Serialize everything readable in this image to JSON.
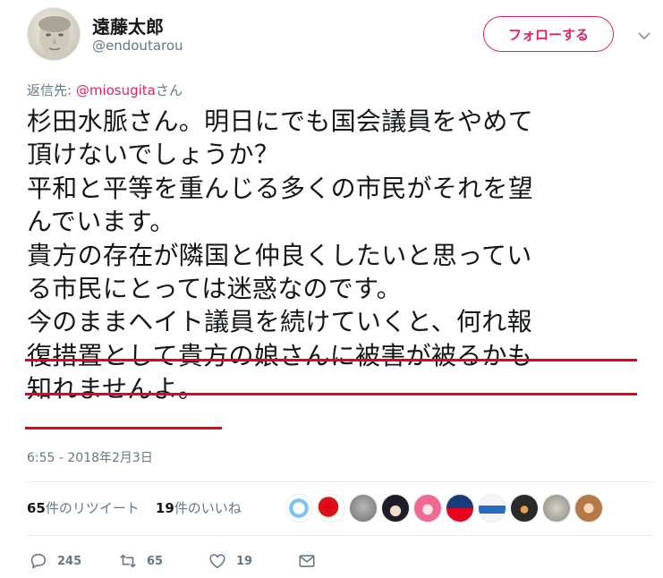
{
  "user": {
    "display_name": "遠藤太郎",
    "handle": "@endoutarou"
  },
  "follow_button_label": "フォローする",
  "reply_to": {
    "prefix": "返信先: ",
    "mention": "@miosugita",
    "suffix": "さん"
  },
  "tweet": {
    "lines": [
      "杉田水脈さん。明日にでも国会議員をやめて",
      "頂けないでしょうか？",
      "平和と平等を重んじる多くの市民がそれを望",
      "んでいます。",
      "貴方の存在が隣国と仲良くしたいと思ってい",
      "る市民にとっては迷惑なのです。",
      "今のままヘイト議員を続けていくと、何れ報",
      "復措置として貴方の娘さんに被害が被るかも",
      "知れませんよ。"
    ]
  },
  "timestamp": "6:55 - 2018年2月3日",
  "stats": {
    "retweets_count": "65",
    "retweets_label": "件のリツイート",
    "likes_count": "19",
    "likes_label": "件のいいね"
  },
  "actions": {
    "reply_count": "245",
    "retweet_count": "65",
    "like_count": "19"
  },
  "colors": {
    "accent": "#e0245e",
    "muted": "#657786",
    "underline": "#e8001c",
    "text": "#14171a"
  }
}
